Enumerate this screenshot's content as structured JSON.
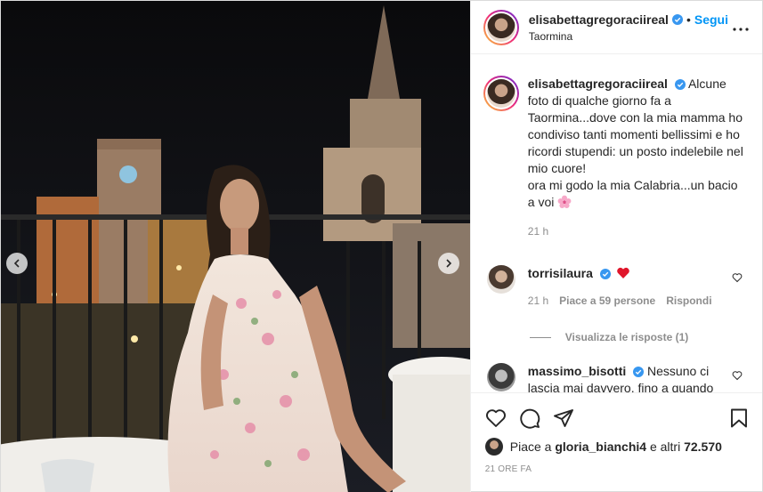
{
  "header": {
    "username": "elisabettagregoraciireal",
    "separator": "•",
    "follow_label": "Segui",
    "location": "Taormina"
  },
  "caption": {
    "username": "elisabettagregoraciireal",
    "text_lines": [
      "Alcune foto di qualche giorno fa a Taormina...dove con la mia mamma ho condiviso tanti momenti bellissimi e ho ricordi stupendi: un posto indelebile nel mio cuore!",
      "ora mi godo la mia Calabria...un bacio a voi"
    ],
    "time": "21 h"
  },
  "comments": [
    {
      "username": "torrisilaura",
      "text": "",
      "time": "21 h",
      "likes": "Piace a 59 persone",
      "reply": "Rispondi",
      "view_replies": "Visualizza le risposte (1)"
    },
    {
      "username": "massimo_bisotti",
      "text": "Nessuno ci lascia mai davvero, fino a quando dentro di noi rimane il profumo"
    }
  ],
  "likes": {
    "prefix": "Piace a ",
    "user": "gloria_bianchi4",
    "suffix": " e altri ",
    "count": "72.570"
  },
  "date": "21 ORE FA",
  "colors": {
    "accent": "#0095f6",
    "verified": "#3897f0",
    "heart": "#ed4956",
    "muted": "#8e8e8e"
  },
  "icons": [
    "heart-icon",
    "comment-icon",
    "share-icon",
    "bookmark-icon",
    "more-icon",
    "verified-icon",
    "chevron-left-icon",
    "chevron-right-icon",
    "cherry-blossom-icon"
  ]
}
